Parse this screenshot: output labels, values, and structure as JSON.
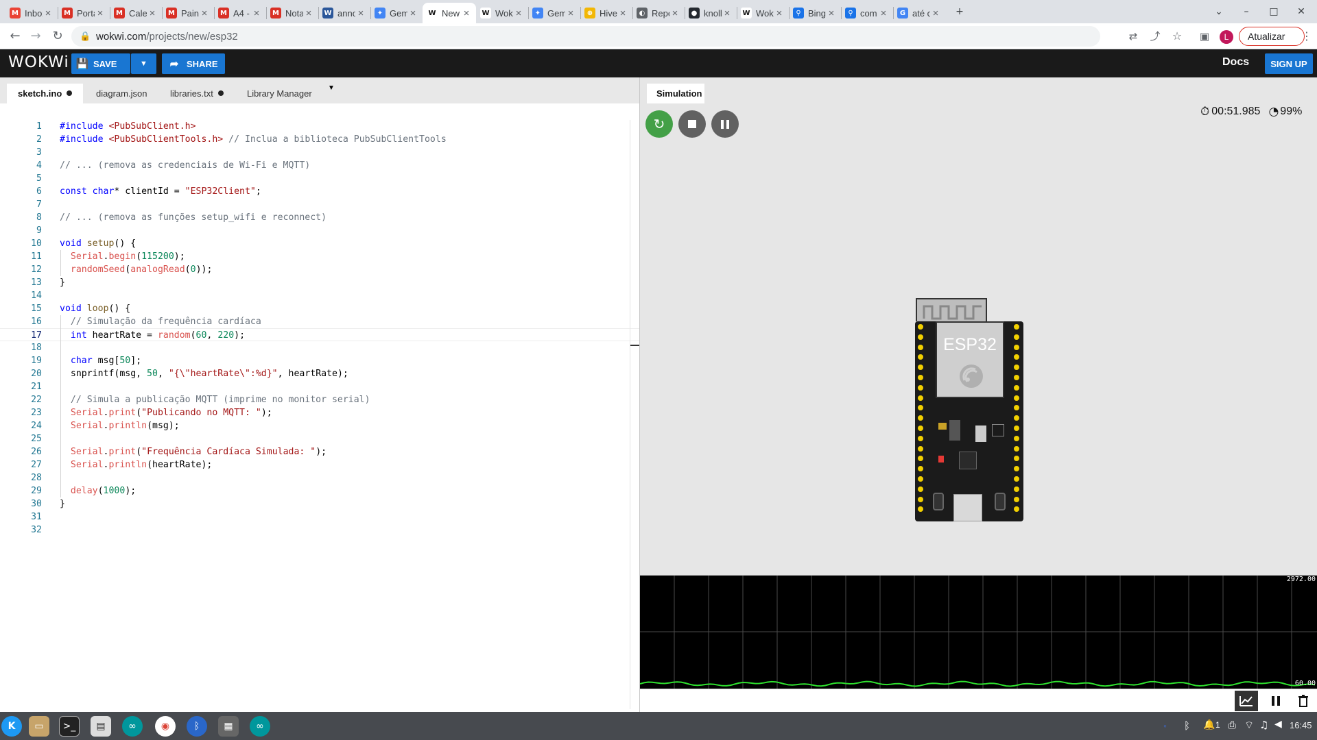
{
  "browser": {
    "tabs": [
      {
        "title": "Inbox",
        "icon": "gmail-icon",
        "color": "#ea4335",
        "glyph": "M",
        "active": false
      },
      {
        "title": "Portal",
        "icon": "moodle-icon",
        "color": "#d93025",
        "glyph": "M",
        "active": false
      },
      {
        "title": "Calendar",
        "icon": "moodle-icon",
        "color": "#d93025",
        "glyph": "M",
        "active": false
      },
      {
        "title": "Painel",
        "icon": "moodle-icon",
        "color": "#d93025",
        "glyph": "M",
        "active": false
      },
      {
        "title": "A4 - ",
        "icon": "moodle-icon",
        "color": "#d93025",
        "glyph": "M",
        "active": false
      },
      {
        "title": "Notas",
        "icon": "moodle-icon",
        "color": "#d93025",
        "glyph": "M",
        "active": false
      },
      {
        "title": "anno",
        "icon": "word-icon",
        "color": "#2b579a",
        "glyph": "W",
        "active": false
      },
      {
        "title": "Gem",
        "icon": "gemini-icon",
        "color": "#4285f4",
        "glyph": "✦",
        "active": false
      },
      {
        "title": "New",
        "icon": "wokwi-icon",
        "color": "#ffffff",
        "glyph": "W",
        "active": true
      },
      {
        "title": "Wokwi",
        "icon": "wokwi-icon",
        "color": "#ffffff",
        "glyph": "W",
        "active": false
      },
      {
        "title": "Gem",
        "icon": "gemini-icon",
        "color": "#4285f4",
        "glyph": "✦",
        "active": false
      },
      {
        "title": "Hivel",
        "icon": "hive-icon",
        "color": "#f2b705",
        "glyph": "⊕",
        "active": false
      },
      {
        "title": "Repo",
        "icon": "repo-icon",
        "color": "#5f6368",
        "glyph": "◐",
        "active": false
      },
      {
        "title": "knoll",
        "icon": "github-icon",
        "color": "#24292f",
        "glyph": "●",
        "active": false
      },
      {
        "title": "Wokwi",
        "icon": "wokwi-icon",
        "color": "#ffffff",
        "glyph": "W",
        "active": false
      },
      {
        "title": "Bing",
        "icon": "search-icon",
        "color": "#1a73e8",
        "glyph": "⚲",
        "active": false
      },
      {
        "title": "com",
        "icon": "search-icon",
        "color": "#1a73e8",
        "glyph": "⚲",
        "active": false
      },
      {
        "title": "até o",
        "icon": "google-icon",
        "color": "#4285f4",
        "glyph": "G",
        "active": false
      }
    ],
    "url_host": "wokwi.com",
    "url_path": "/projects/new/esp32",
    "profile_initial": "L",
    "update_label": "Atualizar"
  },
  "wokwi": {
    "logo": "WOKWi",
    "save_label": "SAVE",
    "share_label": "SHARE",
    "docs_label": "Docs",
    "signup_label": "SIGN UP",
    "editor_tabs": [
      {
        "label": "sketch.ino",
        "dirty": true,
        "active": true
      },
      {
        "label": "diagram.json",
        "dirty": false,
        "active": false
      },
      {
        "label": "libraries.txt",
        "dirty": true,
        "active": false
      },
      {
        "label": "Library Manager",
        "dirty": false,
        "active": false
      }
    ],
    "simulation_tab": "Simulation",
    "timer": "00:51.985",
    "speed": "99%",
    "board_label": "ESP32",
    "plot_max": "2972.00",
    "plot_min": "60.00"
  },
  "code": [
    "#include <PubSubClient.h>",
    "#include <PubSubClientTools.h> // Inclua a biblioteca PubSubClientTools",
    "",
    "// ... (remova as credenciais de Wi-Fi e MQTT)",
    "",
    "const char* clientId = \"ESP32Client\";",
    "",
    "// ... (remova as funções setup_wifi e reconnect)",
    "",
    "void setup() {",
    "  Serial.begin(115200);",
    "  randomSeed(analogRead(0));",
    "}",
    "",
    "void loop() {",
    "  // Simulação da frequência cardíaca",
    "  int heartRate = random(60, 220);",
    "",
    "  char msg[50];",
    "  snprintf(msg, 50, \"{\\\"heartRate\\\":%d}\", heartRate);",
    "",
    "  // Simula a publicação MQTT (imprime no monitor serial)",
    "  Serial.print(\"Publicando no MQTT: \");",
    "  Serial.println(msg);",
    "",
    "  Serial.print(\"Frequência Cardíaca Simulada: \");",
    "  Serial.println(heartRate);",
    "",
    "  delay(1000);",
    "}",
    "",
    ""
  ],
  "current_line": 17,
  "taskbar": {
    "clock": "16:45",
    "tray_count": "1"
  }
}
